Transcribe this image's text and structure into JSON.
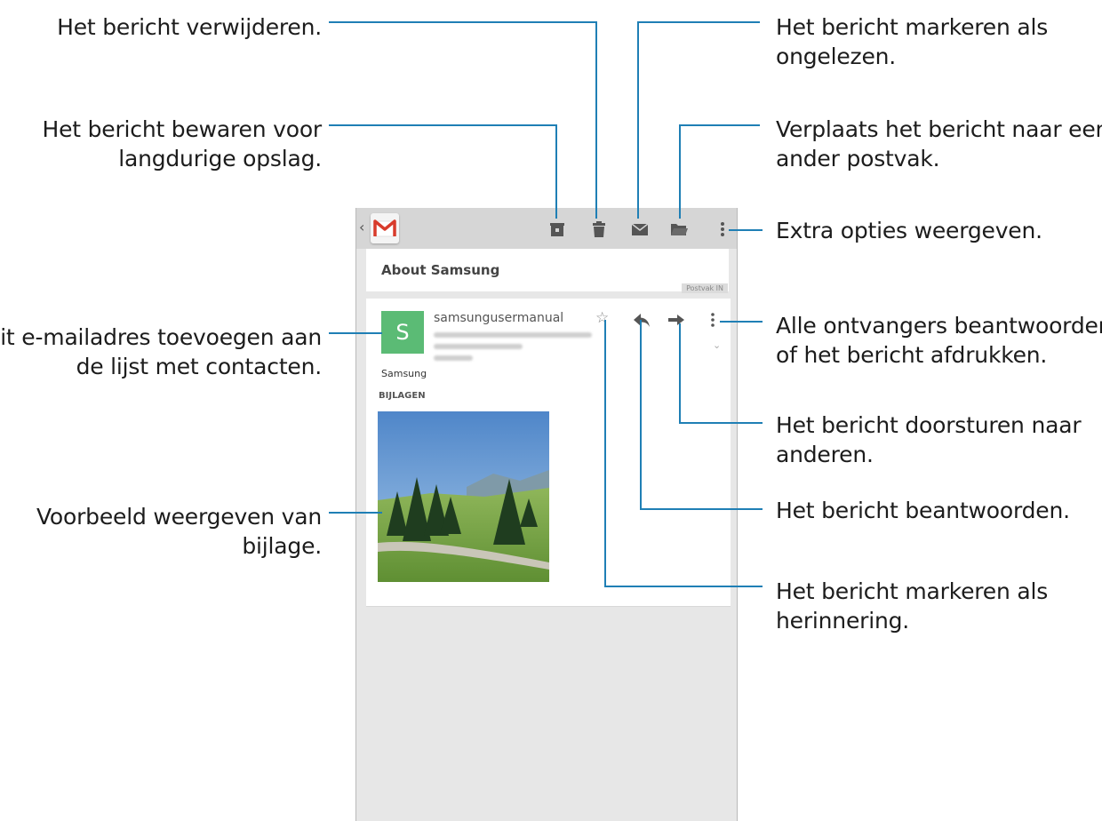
{
  "callouts": {
    "delete": [
      "Het bericht verwijderen."
    ],
    "archive": [
      "Het bericht bewaren voor",
      "langdurige opslag."
    ],
    "add_contact": [
      "Dit e-mailadres toevoegen aan",
      "de lijst met contacten."
    ],
    "preview": [
      "Voorbeeld weergeven van",
      "bijlage."
    ],
    "mark_unread": [
      "Het bericht markeren als",
      "ongelezen."
    ],
    "move": [
      "Verplaats het bericht naar een",
      "ander postvak."
    ],
    "more": [
      "Extra opties weergeven."
    ],
    "reply_all": [
      "Alle ontvangers beantwoorden",
      "of het bericht afdrukken."
    ],
    "forward": [
      "Het bericht doorsturen naar",
      "anderen."
    ],
    "reply": [
      "Het bericht beantwoorden."
    ],
    "star": [
      "Het bericht markeren als",
      "herinnering."
    ]
  },
  "app": {
    "subject": "About Samsung",
    "label": "Postvak IN",
    "avatar_letter": "S",
    "sender": "samsungusermanual",
    "body": "Samsung",
    "attachments_heading": "BIJLAGEN",
    "icons": [
      "back-icon",
      "gmail-icon",
      "archive-icon",
      "trash-icon",
      "mail-icon",
      "folder-icon",
      "overflow-icon",
      "star-icon",
      "reply-icon",
      "forward-icon",
      "expand-icon"
    ],
    "colors": {
      "avatar": "#5bbb75",
      "gmail_red": "#d83b2b",
      "callout_line": "#1f7fb5",
      "actionbar": "#d6d6d6"
    }
  }
}
